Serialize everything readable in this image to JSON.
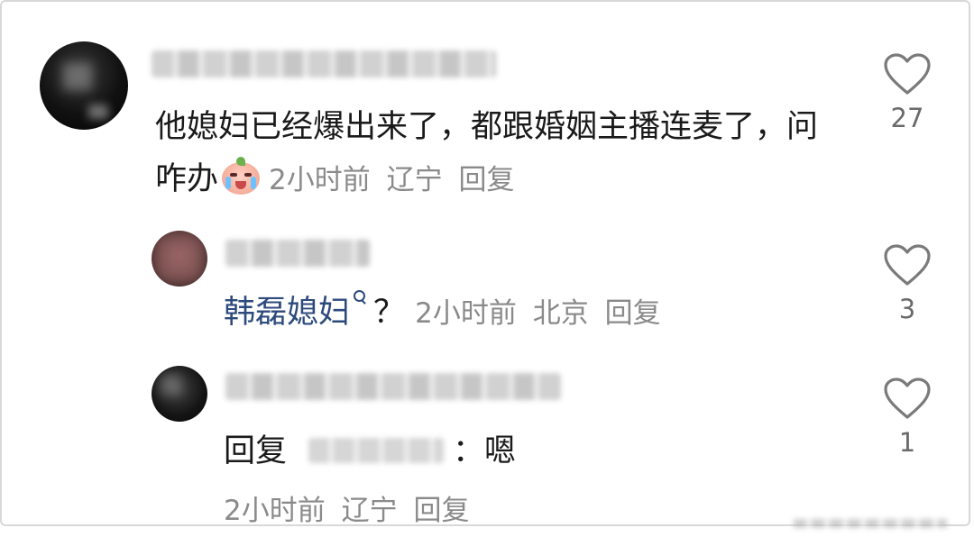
{
  "comments": {
    "top": {
      "username": "",
      "text": "他媳妇已经爆出来了，都跟婚姻主播连麦了，问咋办",
      "emoji": "crying-face-emoji",
      "time": "2小时前",
      "location": "辽宁",
      "reply_label": "回复",
      "likes": "27"
    },
    "reply1": {
      "username": "",
      "link_text": "韩磊媳妇",
      "link_icon": "search-icon",
      "suffix": "？",
      "time": "2小时前",
      "location": "北京",
      "reply_label": "回复",
      "likes": "3"
    },
    "reply2": {
      "username": "",
      "reply_prefix": "回复",
      "mentioned_user": "",
      "separator": "：",
      "text": "嗯",
      "time": "2小时前",
      "location": "辽宁",
      "reply_label": "回复",
      "likes": "1"
    }
  },
  "colors": {
    "text": "#1a1a1a",
    "meta": "#8a8a8a",
    "link": "#2c4a7c",
    "like_outline": "#7a7a7a"
  }
}
